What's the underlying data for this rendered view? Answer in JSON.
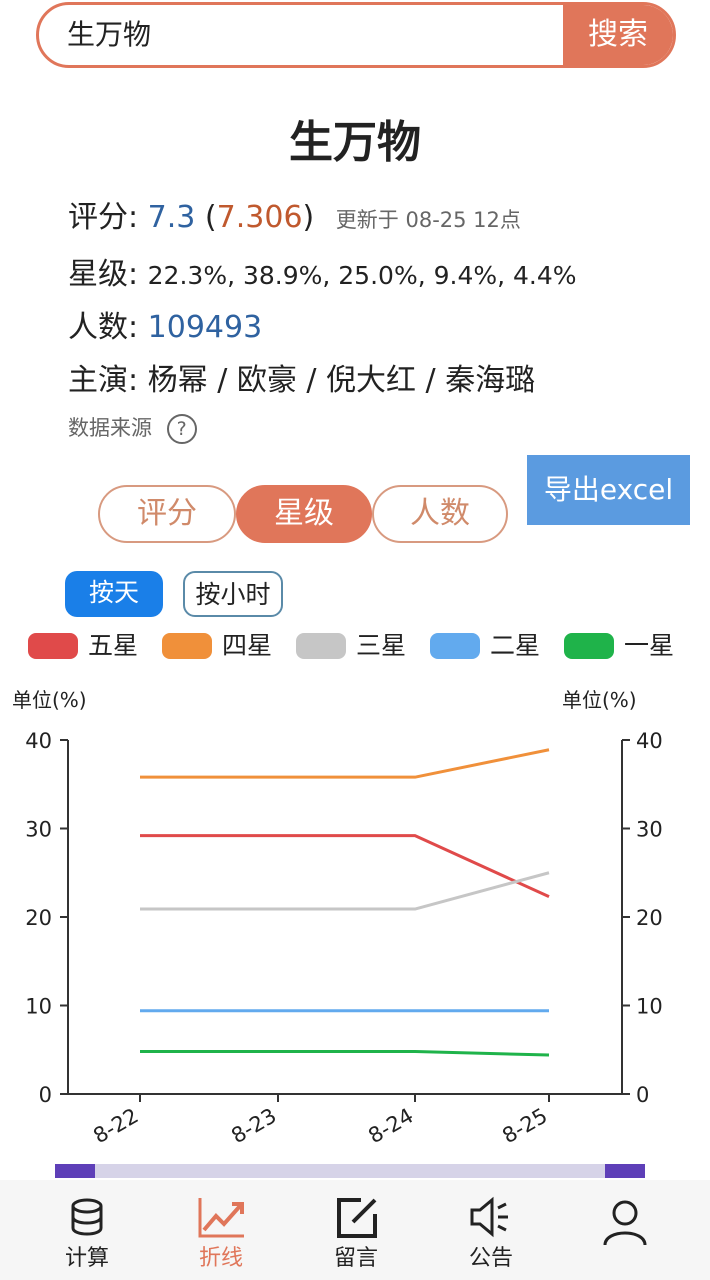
{
  "search": {
    "value": "生万物",
    "button_label": "搜索"
  },
  "title": "生万物",
  "rating": {
    "label": "评分:",
    "value": "7.3",
    "precise": "7.306",
    "paren_open": "(",
    "paren_close": ")",
    "updated": "更新于 08-25 12点"
  },
  "stars": {
    "label": "星级:",
    "values": "22.3%, 38.9%, 25.0%, 9.4%, 4.4%"
  },
  "count": {
    "label": "人数:",
    "value": "109493"
  },
  "cast": {
    "label": "主演:",
    "value": "杨幂 / 欧豪 / 倪大红 / 秦海璐"
  },
  "data_source": {
    "label": "数据来源",
    "icon": "question-circle-icon"
  },
  "export_button": "导出excel",
  "tabs": [
    {
      "label": "评分",
      "active": false
    },
    {
      "label": "星级",
      "active": true
    },
    {
      "label": "人数",
      "active": false
    }
  ],
  "granularity": [
    {
      "label": "按天",
      "active": true
    },
    {
      "label": "按小时",
      "active": false
    }
  ],
  "chart_data": {
    "type": "line",
    "x": [
      "8-22",
      "8-23",
      "8-24",
      "8-25"
    ],
    "ylim": [
      0,
      40
    ],
    "yticks": [
      0,
      10,
      20,
      30,
      40
    ],
    "left_axis_label": "单位(%)",
    "right_axis_label": "单位(%)",
    "legend_position": "top",
    "grid": false,
    "series": [
      {
        "name": "五星",
        "color": "#e04a4a",
        "values": [
          29.2,
          29.2,
          29.2,
          22.3
        ]
      },
      {
        "name": "四星",
        "color": "#f0903a",
        "values": [
          35.8,
          35.8,
          35.8,
          38.9
        ]
      },
      {
        "name": "三星",
        "color": "#c6c6c6",
        "values": [
          20.9,
          20.9,
          20.9,
          25.0
        ]
      },
      {
        "name": "二星",
        "color": "#62aaee",
        "values": [
          9.4,
          9.4,
          9.4,
          9.4
        ]
      },
      {
        "name": "一星",
        "color": "#1fb34a",
        "values": [
          4.8,
          4.8,
          4.8,
          4.4
        ]
      }
    ]
  },
  "nav": [
    {
      "label": "计算",
      "icon": "database-icon",
      "active": false
    },
    {
      "label": "折线",
      "icon": "trend-chart-icon",
      "active": true
    },
    {
      "label": "留言",
      "icon": "edit-icon",
      "active": false
    },
    {
      "label": "公告",
      "icon": "speaker-icon",
      "active": false
    },
    {
      "label": "",
      "icon": "user-icon",
      "active": false
    }
  ]
}
